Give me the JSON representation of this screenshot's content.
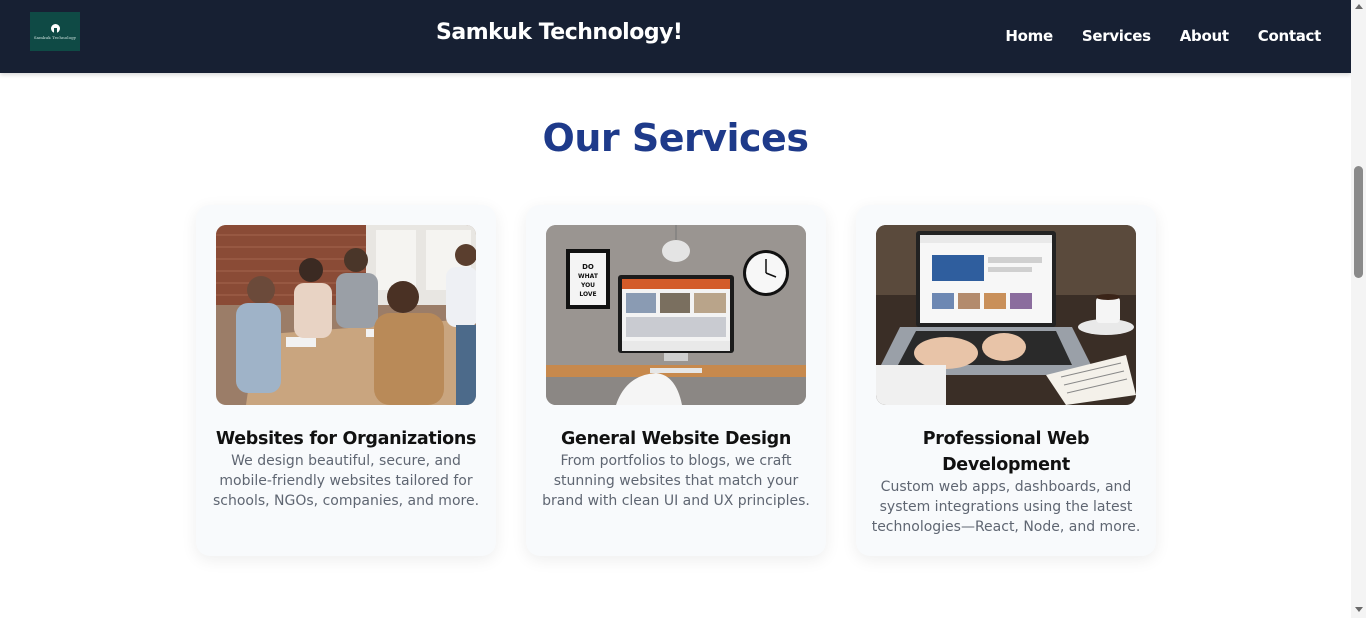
{
  "header": {
    "logo_text": "Samkuk Technology",
    "title": "Samkuk Technology!",
    "nav": [
      "Home",
      "Services",
      "About",
      "Contact"
    ]
  },
  "services": {
    "heading": "Our Services",
    "cards": [
      {
        "title": "Websites for Organizations",
        "description": "We design beautiful, secure, and mobile-friendly websites tailored for schools, NGOs, companies, and more.",
        "image": "team-meeting-photo"
      },
      {
        "title": "General Website Design",
        "description": "From portfolios to blogs, we craft stunning websites that match your brand with clean UI and UX principles.",
        "image": "desk-computer-photo",
        "poster_text": "DO WHAT YOU LOVE"
      },
      {
        "title": "Professional Web Development",
        "description": "Custom web apps, dashboards, and system integrations using the latest technologies—React, Node, and more.",
        "image": "laptop-typing-photo"
      }
    ]
  },
  "colors": {
    "header_bg": "#172033",
    "heading": "#1e3a8a",
    "card_bg": "#f8fafc",
    "logo_bg": "#0f4a45"
  }
}
